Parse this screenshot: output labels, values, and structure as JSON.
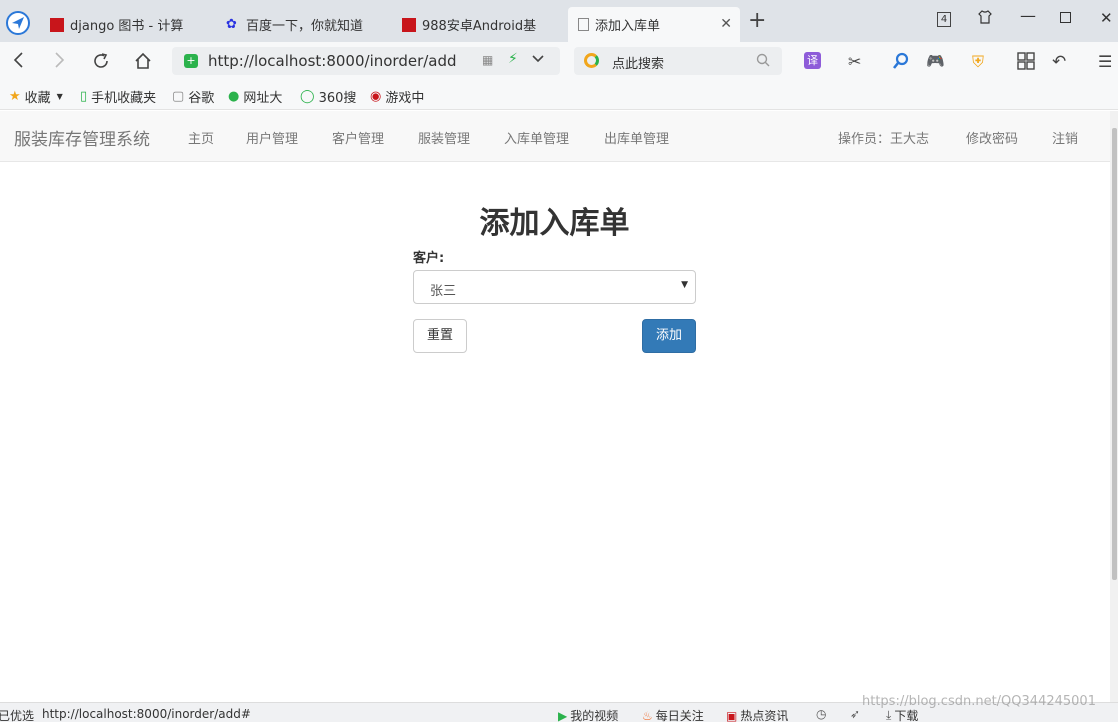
{
  "browser": {
    "tabs": [
      {
        "label": "django 图书 - 计算"
      },
      {
        "label": "百度一下，你就知道"
      },
      {
        "label": "988安卓Android基"
      },
      {
        "label": "添加入库单"
      }
    ],
    "tab_count": "4",
    "url": "http://localhost:8000/inorder/add",
    "search_placeholder": "点此搜索",
    "translate_label": "译"
  },
  "bookmarks": [
    {
      "label": "收藏"
    },
    {
      "label": "手机收藏夹"
    },
    {
      "label": "谷歌"
    },
    {
      "label": "网址大"
    },
    {
      "label": "360搜"
    },
    {
      "label": "游戏中"
    }
  ],
  "navbar": {
    "brand": "服装库存管理系统",
    "links": [
      {
        "label": "主页"
      },
      {
        "label": "用户管理"
      },
      {
        "label": "客户管理"
      },
      {
        "label": "服装管理"
      },
      {
        "label": "入库单管理"
      },
      {
        "label": "出库单管理"
      }
    ],
    "operator": "操作员：王大志",
    "change_password": "修改密码",
    "logout": "注销"
  },
  "form": {
    "title": "添加入库单",
    "customer_label": "客户:",
    "customer_value": "张三",
    "reset_label": "重置",
    "submit_label": "添加"
  },
  "statusbar": {
    "left_text": "已优选",
    "hover_url": "http://localhost:8000/inorder/add#",
    "my_video": "我的视频",
    "daily_follow": "每日关注",
    "hot_news": "热点资讯",
    "download": "下载",
    "watermark": "https://blog.csdn.net/QQ344245001"
  },
  "colors": {
    "primary": "#337ab7",
    "navbar_bg": "#f8f8f8",
    "tab_bg": "#dfe3e8"
  }
}
